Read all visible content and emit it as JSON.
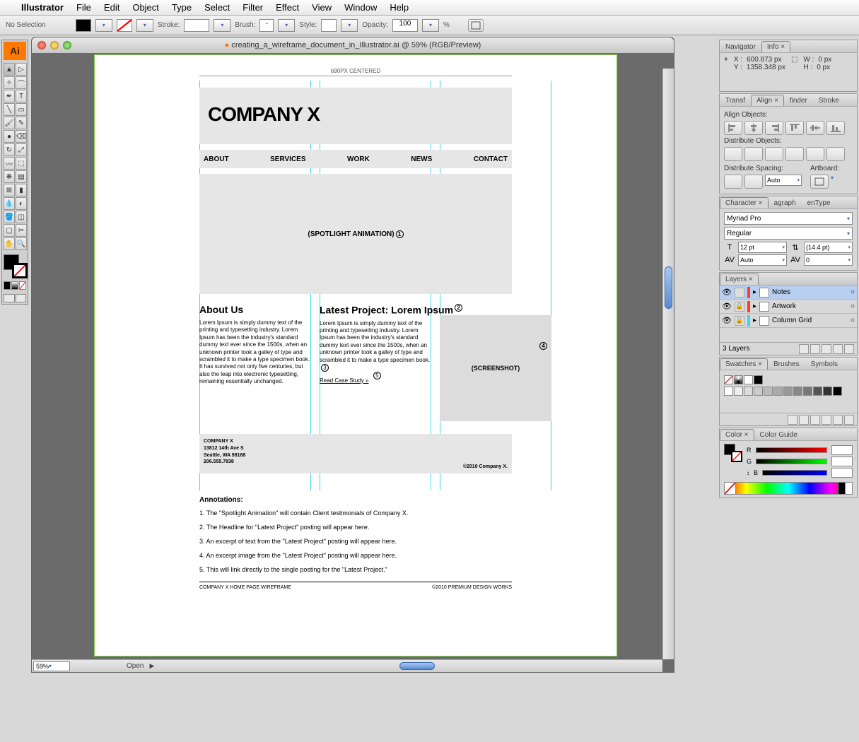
{
  "menubar": {
    "app": "Illustrator",
    "items": [
      "File",
      "Edit",
      "Object",
      "Type",
      "Select",
      "Filter",
      "Effect",
      "View",
      "Window",
      "Help"
    ]
  },
  "controlbar": {
    "selection": "No Selection",
    "stroke_label": "Stroke:",
    "brush_label": "Brush:",
    "style_label": "Style:",
    "opacity_label": "Opacity:",
    "opacity_value": "100",
    "opacity_unit": "%"
  },
  "document": {
    "title": "creating_a_wireframe_document_in_Illustrator.ai @ 59% (RGB/Preview)",
    "zoom": "59%",
    "status": "Open"
  },
  "wireframe": {
    "measure_label": "690PX CENTERED",
    "company": "COMPANY X",
    "nav": [
      "ABOUT",
      "SERVICES",
      "WORK",
      "NEWS",
      "CONTACT"
    ],
    "spotlight": "(SPOTLIGHT ANIMATION)",
    "about_h": "About Us",
    "about_body": "Lorem Ipsum is simply dummy text of the printing and typesetting industry. Lorem Ipsum has been the industry's standard dummy text ever since the 1500s, when an unknown printer took a galley of type and scrambled it to make a type specimen book. It has survived not only five centuries, but also the leap into electronic typesetting, remaining essentially unchanged.",
    "project_h": "Latest Project: Lorem Ipsum",
    "project_body": "Lorem Ipsum is simply dummy text of the printing and typesetting industry. Lorem Ipsum has been the industry's standard dummy text ever since the 1500s, when an unknown printer took a galley of type and scrambled it to make a type specimen book.",
    "project_link": "Read Case Study »",
    "screenshot": "(SCREENSHOT)",
    "footer_company": "COMPANY X",
    "footer_addr1": "13812 14th Ave S",
    "footer_addr2": "Seattle, WA 98168",
    "footer_phone": "206.555.7838",
    "footer_copy": "©2010 Company X.",
    "doc_footer_left": "COMPANY X HOME PAGE WIREFRAME",
    "doc_footer_right": "©2010 PREMIUM DESIGN WORKS"
  },
  "annotations": {
    "heading": "Annotations:",
    "items": [
      "1. The \"Spotlight Animation\" will contain Client testimonials of Company X.",
      "2. The Headline for \"Latest Project\" posting will appear here.",
      "3. An excerpt of text from the \"Latest Project\" posting will appear here.",
      "4. An excerpt image from the \"Latest Project\" posting will appear here.",
      "5. This will link directly to the single posting for the \"Latest Project.\""
    ]
  },
  "panels": {
    "info": {
      "tabs": [
        "Navigator",
        "Info"
      ],
      "x_label": "X :",
      "x": "600.873 px",
      "y_label": "Y :",
      "y": "1358.348 px",
      "w_label": "W :",
      "w": "0 px",
      "h_label": "H :",
      "h": "0 px"
    },
    "align": {
      "tabs": [
        "Transf",
        "Align",
        "finder",
        "Stroke"
      ],
      "h1": "Align Objects:",
      "h2": "Distribute Objects:",
      "h3": "Distribute Spacing:",
      "h4": "Artboard:",
      "auto": "Auto"
    },
    "character": {
      "tabs": [
        "Character",
        "agraph",
        "enType"
      ],
      "font": "Myriad Pro",
      "weight": "Regular",
      "size": "12 pt",
      "leading": "(14.4 pt)",
      "kern": "Auto",
      "track": "0"
    },
    "layers": {
      "tab": "Layers",
      "items": [
        {
          "name": "Notes",
          "color": "#ff3b30",
          "locked": false,
          "selected": true
        },
        {
          "name": "Artwork",
          "color": "#ff3b30",
          "locked": true,
          "selected": false
        },
        {
          "name": "Column Grid",
          "color": "#3cd6e6",
          "locked": true,
          "selected": false
        }
      ],
      "count": "3 Layers"
    },
    "swatches": {
      "tabs": [
        "Swatches",
        "Brushes",
        "Symbols"
      ]
    },
    "color": {
      "tabs": [
        "Color",
        "Color Guide"
      ],
      "r": "R",
      "g": "G",
      "b": "B"
    }
  }
}
